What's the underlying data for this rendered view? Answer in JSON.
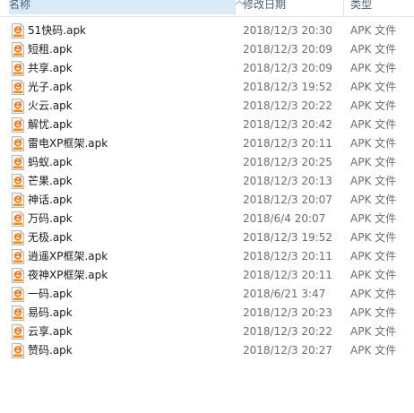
{
  "header": {
    "name_label": "名称",
    "date_label": "修改日期",
    "type_label": "类型"
  },
  "colors": {
    "header_selected_bg": "#d9ebf9",
    "header_text": "#4c607a",
    "icon_orange": "#f08c1a",
    "icon_red": "#d9301f",
    "secondary_text": "#6d6d6d"
  },
  "icons": {
    "file": "apk-file-icon",
    "sort": "chevron-up-icon"
  },
  "files": [
    {
      "name": "51快码.apk",
      "date": "2018/12/3 20:30",
      "type": "APK 文件"
    },
    {
      "name": "短租.apk",
      "date": "2018/12/3 20:09",
      "type": "APK 文件"
    },
    {
      "name": "共享.apk",
      "date": "2018/12/3 20:09",
      "type": "APK 文件"
    },
    {
      "name": "光子.apk",
      "date": "2018/12/3 19:52",
      "type": "APK 文件"
    },
    {
      "name": "火云.apk",
      "date": "2018/12/3 20:22",
      "type": "APK 文件"
    },
    {
      "name": "解忧.apk",
      "date": "2018/12/3 20:42",
      "type": "APK 文件"
    },
    {
      "name": "雷电XP框架.apk",
      "date": "2018/12/3 20:11",
      "type": "APK 文件"
    },
    {
      "name": "蚂蚁.apk",
      "date": "2018/12/3 20:25",
      "type": "APK 文件"
    },
    {
      "name": "芒果.apk",
      "date": "2018/12/3 20:13",
      "type": "APK 文件"
    },
    {
      "name": "神话.apk",
      "date": "2018/12/3 20:07",
      "type": "APK 文件"
    },
    {
      "name": "万码.apk",
      "date": "2018/6/4 20:07",
      "type": "APK 文件"
    },
    {
      "name": "无极.apk",
      "date": "2018/12/3 19:52",
      "type": "APK 文件"
    },
    {
      "name": "逍遥XP框架.apk",
      "date": "2018/12/3 20:11",
      "type": "APK 文件"
    },
    {
      "name": "夜神XP框架.apk",
      "date": "2018/12/3 20:11",
      "type": "APK 文件"
    },
    {
      "name": "一码.apk",
      "date": "2018/6/21 3:47",
      "type": "APK 文件"
    },
    {
      "name": "易码.apk",
      "date": "2018/12/3 20:23",
      "type": "APK 文件"
    },
    {
      "name": "云享.apk",
      "date": "2018/12/3 20:22",
      "type": "APK 文件"
    },
    {
      "name": "赞码.apk",
      "date": "2018/12/3 20:27",
      "type": "APK 文件"
    }
  ]
}
